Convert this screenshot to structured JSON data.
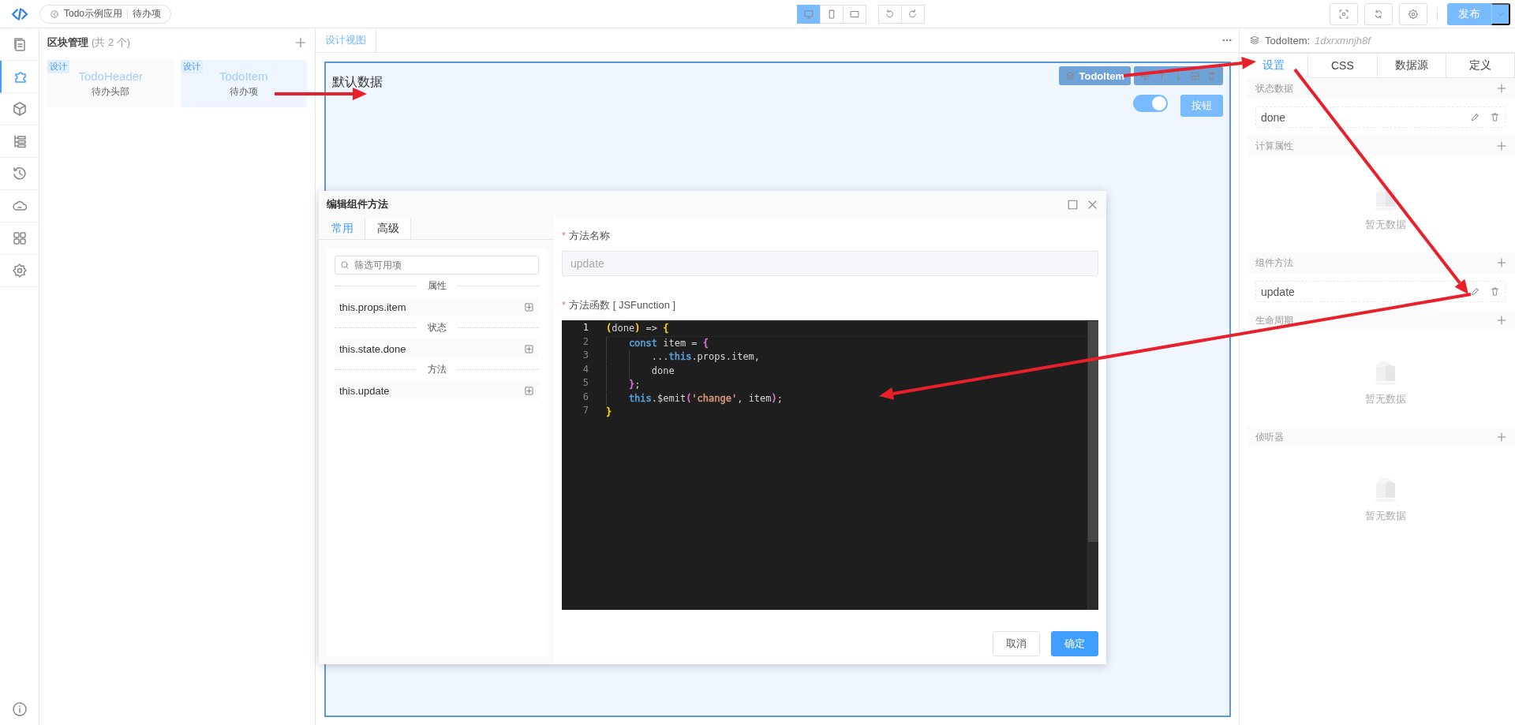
{
  "topbar": {
    "app_button": {
      "label": "Todo示例应用",
      "page": "待办项"
    },
    "devices": [
      {
        "kind": "desktop",
        "selected": true
      },
      {
        "kind": "phone",
        "selected": false
      },
      {
        "kind": "tablet",
        "selected": false
      }
    ],
    "history": [
      {
        "kind": "undo"
      },
      {
        "kind": "redo"
      }
    ],
    "tools": [
      {
        "kind": "preview"
      },
      {
        "kind": "refresh"
      },
      {
        "kind": "settings"
      }
    ],
    "publish": "发布"
  },
  "rail": [
    {
      "kind": "pages",
      "selected": false
    },
    {
      "kind": "blocks",
      "selected": true
    },
    {
      "kind": "cube",
      "selected": false
    },
    {
      "kind": "tree",
      "selected": false
    },
    {
      "kind": "history",
      "selected": false
    },
    {
      "kind": "api",
      "selected": false
    },
    {
      "kind": "apps",
      "selected": false
    },
    {
      "kind": "settings",
      "selected": false
    }
  ],
  "rail_bottom": {
    "kind": "info"
  },
  "blocks_panel": {
    "title": "区块管理",
    "count": "(共 2 个)",
    "blocks": [
      {
        "tag": "设计",
        "name": "TodoHeader",
        "desc": "待办头部",
        "selected": false
      },
      {
        "tag": "设计",
        "name": "TodoItem",
        "desc": "待办项",
        "selected": true
      }
    ]
  },
  "canvas": {
    "tabs": [
      {
        "label": "设计视图",
        "selected": true
      }
    ],
    "text": "默认数据",
    "toolbar": {
      "component": "TodoItem"
    },
    "switch": {
      "on": true
    },
    "button": "按钮"
  },
  "dialog": {
    "title": "编辑组件方法",
    "tabs": [
      {
        "label": "常用",
        "selected": true
      },
      {
        "label": "高级",
        "selected": false
      }
    ],
    "filter_placeholder": "筛选可用项",
    "groups": [
      {
        "title": "属性",
        "items": [
          "this.props.item"
        ]
      },
      {
        "title": "状态",
        "items": [
          "this.state.done"
        ]
      },
      {
        "title": "方法",
        "items": [
          "this.update"
        ]
      }
    ],
    "name_label": {
      "mark": "*",
      "text": "方法名称"
    },
    "name_value": "update",
    "function_label": {
      "mark": "*",
      "text": "方法函数 [ JSFunction ]"
    },
    "code": [
      {
        "no": "1",
        "current": true,
        "tokens": [
          {
            "t": "(",
            "color": "#ffd700"
          },
          {
            "t": "done"
          },
          {
            "t": ")",
            "color": "#ffd700"
          },
          {
            "t": " => "
          },
          {
            "t": "{",
            "color": "#ffd700"
          }
        ],
        "children": [
          {
            "no": "2",
            "current": false,
            "tokens": [
              {
                "t": "const",
                "color": "#569cd6"
              },
              {
                "t": " item = "
              },
              {
                "t": "{",
                "color": "#da70d6"
              }
            ],
            "children": [
              {
                "no": "3",
                "current": false,
                "tokens": [
                  {
                    "t": "..."
                  },
                  {
                    "t": "this",
                    "color": "#569cd6"
                  },
                  {
                    "t": ".props.item,"
                  }
                ]
              },
              {
                "no": "4",
                "current": false,
                "tokens": [
                  {
                    "t": "done"
                  }
                ]
              }
            ]
          },
          {
            "no": "5",
            "current": false,
            "tokens": [
              {
                "t": "}",
                "color": "#da70d6"
              },
              {
                "t": ";"
              }
            ]
          },
          {
            "no": "6",
            "current": false,
            "tokens": [
              {
                "t": "this",
                "color": "#569cd6"
              },
              {
                "t": ".$emit"
              },
              {
                "t": "(",
                "color": "#da70d6"
              },
              {
                "t": "'change'",
                "color": "#ce9178"
              },
              {
                "t": ", item"
              },
              {
                "t": ")",
                "color": "#da70d6"
              },
              {
                "t": ";"
              }
            ]
          }
        ]
      },
      {
        "no": "7",
        "current": false,
        "tokens": [
          {
            "t": "}",
            "color": "#ffd700"
          }
        ]
      }
    ],
    "cancel": "取消",
    "ok": "确定"
  },
  "right_panel": {
    "component": "TodoItem:",
    "id": "1dxrxmnjh8f",
    "tabs": [
      {
        "label": "设置",
        "selected": true
      },
      {
        "label": "CSS",
        "selected": false
      },
      {
        "label": "数据源",
        "selected": false
      },
      {
        "label": "定义",
        "selected": false
      }
    ],
    "sections": [
      {
        "title": "状态数据",
        "items": [
          "done"
        ]
      },
      {
        "title": "计算属性",
        "empty": "暂无数据"
      },
      {
        "title": "组件方法",
        "items": [
          "update"
        ]
      },
      {
        "title": "生命周期",
        "empty": "暂无数据"
      },
      {
        "title": "侦听器",
        "empty": "暂无数据"
      }
    ]
  },
  "annotations": [
    {
      "kind": "arrow"
    },
    {
      "kind": "arrow"
    },
    {
      "kind": "arrow"
    },
    {
      "kind": "arrow"
    }
  ]
}
